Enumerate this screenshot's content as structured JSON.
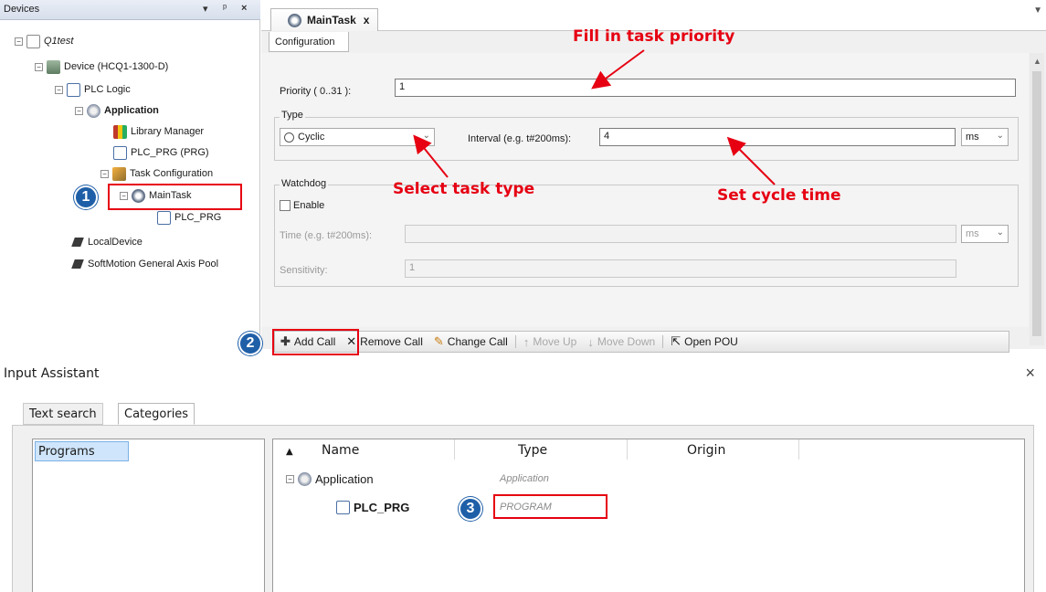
{
  "devices_pane": {
    "title": "Devices",
    "controls": [
      "▾",
      "ᵖ",
      "×"
    ],
    "tree": {
      "project": "Q1test",
      "device": "Device (HCQ1-1300-D)",
      "plc_logic": "PLC Logic",
      "application": "Application",
      "library_manager": "Library Manager",
      "plc_prg": "PLC_PRG (PRG)",
      "task_configuration": "Task Configuration",
      "main_task": "MainTask",
      "main_task_call": "PLC_PRG",
      "local_device": "LocalDevice",
      "softmotion_pool": "SoftMotion General Axis Pool"
    }
  },
  "editor": {
    "tab_title": "MainTask",
    "tab_close": "x",
    "sub_tab": "Configuration",
    "priority_label": "Priority ( 0..31 ):",
    "priority_value": "1",
    "type_group_label": "Type",
    "type_value": "Cyclic",
    "interval_label": "Interval (e.g. t#200ms):",
    "interval_value": "4",
    "interval_unit": "ms",
    "watchdog_group_label": "Watchdog",
    "enable_label": "Enable",
    "time_label": "Time (e.g. t#200ms):",
    "time_unit": "ms",
    "sensitivity_label": "Sensitivity:",
    "sensitivity_value": "1"
  },
  "toolbar": {
    "add_call": "Add Call",
    "remove_call": "Remove Call",
    "change_call": "Change Call",
    "move_up": "Move Up",
    "move_down": "Move Down",
    "open_pou": "Open POU"
  },
  "annotations": {
    "fill_priority": "Fill in task priority",
    "select_type": "Select task type",
    "set_cycle": "Set cycle time",
    "badge_1": "1",
    "badge_2": "2",
    "badge_3": "3",
    "annotation_color": "#e60012",
    "badge_color": "#1f5fa8"
  },
  "input_assistant": {
    "title": "Input Assistant",
    "close": "×",
    "tabs": [
      "Text search",
      "Categories"
    ],
    "category": "Programs",
    "columns": [
      "Name",
      "Type",
      "Origin"
    ],
    "sort_indicator": "▲",
    "rows": [
      {
        "name": "Application",
        "type": "Application"
      },
      {
        "name": "PLC_PRG",
        "type": "PROGRAM"
      }
    ]
  }
}
